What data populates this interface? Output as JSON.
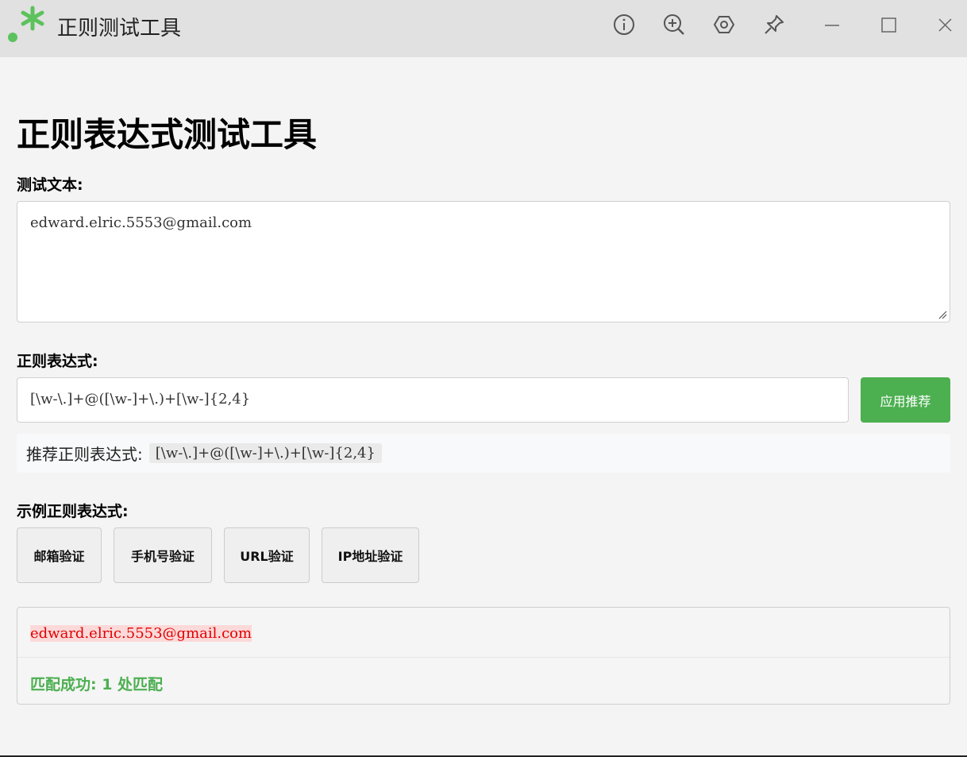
{
  "window": {
    "title": "正则测试工具",
    "accent_color": "#5cc25c"
  },
  "titlebar_icons": [
    "info-icon",
    "zoom-in-icon",
    "settings-icon",
    "pin-icon",
    "minimize-icon",
    "maximize-icon",
    "close-icon"
  ],
  "page": {
    "title": "正则表达式测试工具"
  },
  "test_text": {
    "label": "测试文本:",
    "value": "edward.elric.5553@gmail.com"
  },
  "regex": {
    "label": "正则表达式:",
    "value": "[\\w-\\.]+@([\\w-]+\\.)+[\\w-]{2,4}",
    "apply_button": "应用推荐",
    "suggest_label": "推荐正则表达式:",
    "suggest_value": "[\\w-\\.]+@([\\w-]+\\.)+[\\w-]{2,4}"
  },
  "examples": {
    "label": "示例正则表达式:",
    "buttons": [
      "邮箱验证",
      "手机号验证",
      "URL验证",
      "IP地址验证"
    ]
  },
  "result": {
    "matched_text": "edward.elric.5553@gmail.com",
    "status": "匹配成功: 1 处匹配",
    "status_color": "#4caf50",
    "match_color": "#e00000"
  }
}
